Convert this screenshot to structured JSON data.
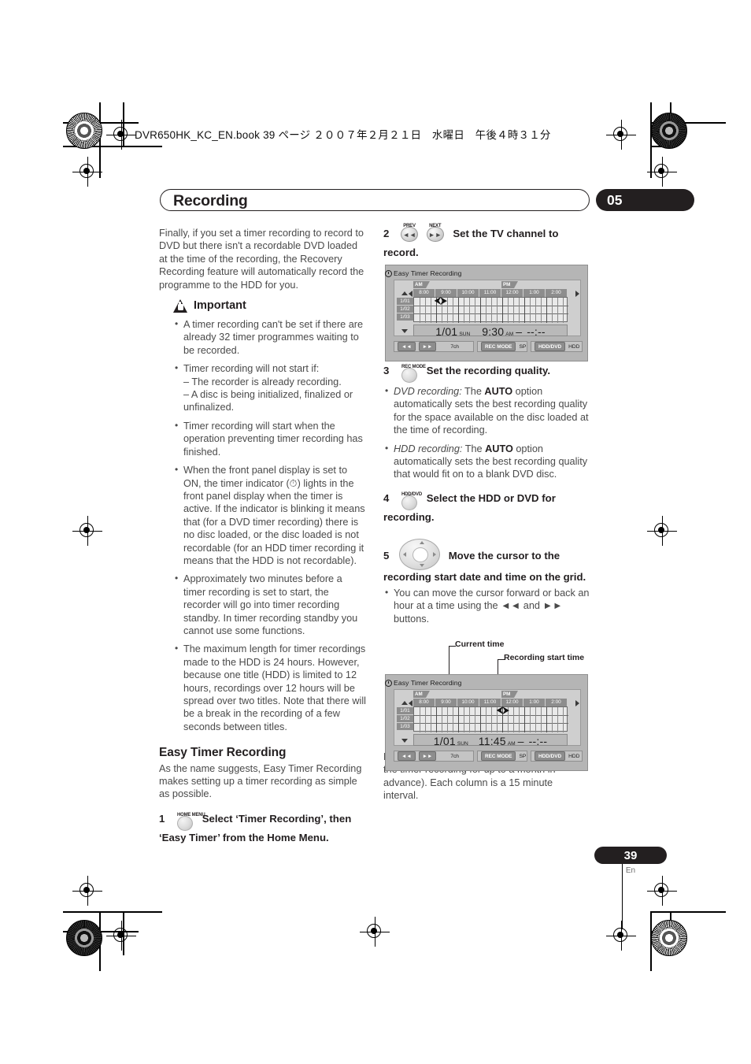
{
  "header": {
    "book_line": "DVR650HK_KC_EN.book  39 ページ  ２００７年２月２１日　水曜日　午後４時３１分"
  },
  "title_bar": {
    "title": "Recording",
    "chapter": "05"
  },
  "left_column": {
    "intro": "Finally, if you set a timer recording to record to DVD but there isn't a recordable DVD loaded at the time of the recording, the Recovery Recording feature will automatically record the programme to the HDD for you.",
    "important_label": "Important",
    "important_items": [
      "A timer recording can't be set if there are already 32 timer programmes waiting to be recorded.",
      "Timer recording will not start if:\n– The recorder is already recording.\n– A disc is being initialized, finalized or unfinalized.",
      "Timer recording will start when the operation preventing timer recording has finished.",
      "When the front panel display is set to ON, the timer indicator (⏱) lights in the front panel display when the timer is active. If the indicator is blinking it means that (for a DVD timer recording) there is no disc loaded, or the disc loaded is not recordable (for an HDD timer recording it means that the HDD is not recordable).",
      "Approximately two minutes before a timer recording is set to start, the recorder will go into timer recording standby. In timer recording standby you cannot use some functions.",
      "The maximum length for timer recordings made to the HDD is 24 hours. However, because one title (HDD) is limited to 12 hours, recordings over 12 hours will be spread over two titles. Note that there will be a break in the recording of a few seconds between titles."
    ],
    "section_heading": "Easy Timer Recording",
    "section_body": "As the name suggests, Easy Timer Recording makes setting up a timer recording as simple as possible.",
    "step1": {
      "num": "1",
      "key_label": "HOME MENU",
      "text": "Select ‘Timer Recording’, then ‘Easy Timer’ from the Home Menu."
    }
  },
  "right_column": {
    "step2": {
      "num": "2",
      "key_prev_label": "PREV",
      "key_next_label": "NEXT",
      "key_prev_glyph": "◄◄",
      "key_next_glyph": "►►",
      "text": "Set the TV channel to record."
    },
    "step3": {
      "num": "3",
      "key_label": "REC MODE",
      "text": "Set the recording quality.",
      "bullets": [
        {
          "italic": "DVD recording:",
          "pre": " The ",
          "bold": "AUTO",
          "post": " option automatically sets the best recording quality for the space available on the disc loaded at the time of recording."
        },
        {
          "italic": "HDD recording:",
          "pre": " The ",
          "bold": "AUTO",
          "post": " option automatically sets the best recording quality that would fit on to a blank DVD disc."
        }
      ]
    },
    "step4": {
      "num": "4",
      "key_label": "HDD/DVD",
      "text": "Select the HDD or DVD for recording."
    },
    "step5": {
      "num": "5",
      "text": "Move the cursor to the recording start date and time on the grid.",
      "bullet": "You can move the cursor forward or back an hour at a time using the ◄◄ and ►► buttons."
    },
    "closing": "Each row of the grid is one day (you can set the timer recording for up to a month in advance). Each column is a 15 minute interval."
  },
  "screens": [
    {
      "id": "screen-top",
      "osd_title": "Easy Timer Recording",
      "am_label": "AM",
      "pm_label": "PM",
      "hours": [
        "8:00",
        "9:00",
        "10:00",
        "11:00",
        "12:00",
        "1:00",
        "2:00"
      ],
      "days": [
        "1/01",
        "1/02",
        "1/03"
      ],
      "cursor_column_index": 4,
      "info_date": "1/01",
      "info_weekday": "SUN",
      "info_time": "9:30",
      "info_meridiem": "AM",
      "info_dash": "–",
      "info_end": "--:--",
      "footer": {
        "prev_glyph": "◄◄",
        "next_glyph": "►►",
        "channel": "7ch",
        "recmode_chip": "REC MODE",
        "recmode_value": "SP",
        "hdddvd_chip": "HDD/DVD",
        "hdddvd_value": "HDD"
      }
    },
    {
      "id": "screen-bottom",
      "osd_title": "Easy Timer Recording",
      "am_label": "AM",
      "pm_label": "PM",
      "hours": [
        "8:00",
        "9:00",
        "10:00",
        "11:00",
        "12:00",
        "1:00",
        "2:00"
      ],
      "days": [
        "1/01",
        "1/02",
        "1/03"
      ],
      "cursor_column_index": 15,
      "info_date": "1/01",
      "info_weekday": "SUN",
      "info_time": "11:45",
      "info_meridiem": "AM",
      "info_dash": "–",
      "info_end": "--:--",
      "footer": {
        "prev_glyph": "◄◄",
        "next_glyph": "►►",
        "channel": "7ch",
        "recmode_chip": "REC MODE",
        "recmode_value": "SP",
        "hdddvd_chip": "HDD/DVD",
        "hdddvd_value": "HDD"
      }
    }
  ],
  "callouts": {
    "current_time": "Current time",
    "recording_start_time": "Recording start time"
  },
  "footer": {
    "page_number": "39",
    "language": "En"
  }
}
